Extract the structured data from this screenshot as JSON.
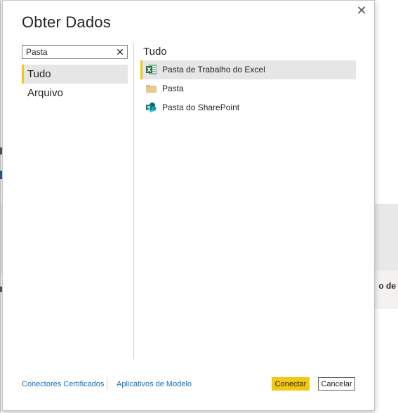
{
  "dialog": {
    "title": "Obter Dados",
    "close_icon": "close-icon"
  },
  "search": {
    "value": "Pasta",
    "clear_icon": "clear-icon"
  },
  "categories": [
    {
      "label": "Tudo",
      "selected": true
    },
    {
      "label": "Arquivo",
      "selected": false
    }
  ],
  "results": {
    "section_title": "Tudo",
    "items": [
      {
        "label": "Pasta de Trabalho do Excel",
        "icon": "excel-icon",
        "selected": true
      },
      {
        "label": "Pasta",
        "icon": "folder-icon",
        "selected": false
      },
      {
        "label": "Pasta do SharePoint",
        "icon": "sharepoint-icon",
        "selected": false
      }
    ]
  },
  "footer": {
    "certified_connectors_label": "Conectores Certificados",
    "template_apps_label": "Aplicativos de Modelo",
    "connect_label": "Conectar",
    "cancel_label": "Cancelar"
  },
  "background": {
    "card_text": "o de"
  },
  "colors": {
    "accent": "#f2c811",
    "link": "#106ebe",
    "selected_bg": "#e6e6e6",
    "excel": "#217346",
    "sharepoint": "#038387",
    "folder": "#dcb67a"
  }
}
